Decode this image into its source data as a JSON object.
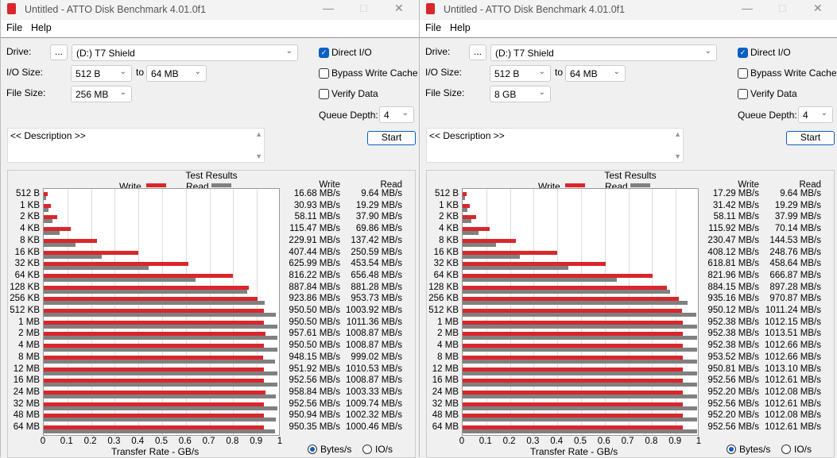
{
  "windows": [
    {
      "title": "Untitled - ATTO Disk Benchmark 4.01.0f1",
      "menu": [
        "File",
        "Help"
      ],
      "drive_label": "Drive:",
      "browse_label": "...",
      "drive": "(D:) T7 Shield",
      "io_size_label": "I/O Size:",
      "io_from": "512 B",
      "to_label": "to",
      "io_to": "64 MB",
      "file_size_label": "File Size:",
      "file_size": "256 MB",
      "direct_io": {
        "label": "Direct I/O",
        "checked": true
      },
      "bypass_write_cache": {
        "label": "Bypass Write Cache",
        "checked": false
      },
      "verify_data": {
        "label": "Verify Data",
        "checked": false
      },
      "queue_depth_label": "Queue Depth:",
      "queue_depth": "4",
      "description": "<< Description >>",
      "start_label": "Start",
      "results_title": "Test Results",
      "legend_write": "Write",
      "legend_read": "Read",
      "col_write": "Write",
      "col_read": "Read",
      "axis_label": "Transfer Rate - GB/s",
      "ticks": [
        "0",
        "0.1",
        "0.2",
        "0.3",
        "0.4",
        "0.5",
        "0.6",
        "0.7",
        "0.8",
        "0.9",
        "1"
      ],
      "radio_bytes": "Bytes/s",
      "radio_io": "IO/s",
      "units_selected": "bytes",
      "rows": [
        "512 B",
        "1 KB",
        "2 KB",
        "4 KB",
        "8 KB",
        "16 KB",
        "32 KB",
        "64 KB",
        "128 KB",
        "256 KB",
        "512 KB",
        "1 MB",
        "2 MB",
        "4 MB",
        "8 MB",
        "12 MB",
        "16 MB",
        "24 MB",
        "32 MB",
        "48 MB",
        "64 MB"
      ],
      "write": [
        "16.68 MB/s",
        "30.93 MB/s",
        "58.11 MB/s",
        "115.47 MB/s",
        "229.91 MB/s",
        "407.44 MB/s",
        "625.99 MB/s",
        "816.22 MB/s",
        "887.84 MB/s",
        "923.86 MB/s",
        "950.50 MB/s",
        "950.50 MB/s",
        "957.61 MB/s",
        "950.50 MB/s",
        "948.15 MB/s",
        "951.92 MB/s",
        "952.56 MB/s",
        "958.84 MB/s",
        "952.56 MB/s",
        "950.94 MB/s",
        "950.35 MB/s"
      ],
      "read": [
        "9.64 MB/s",
        "19.29 MB/s",
        "37.90 MB/s",
        "69.86 MB/s",
        "137.42 MB/s",
        "250.59 MB/s",
        "453.54 MB/s",
        "656.48 MB/s",
        "881.28 MB/s",
        "953.73 MB/s",
        "1003.92 MB/s",
        "1011.36 MB/s",
        "1008.87 MB/s",
        "1008.87 MB/s",
        "999.02 MB/s",
        "1010.53 MB/s",
        "1008.87 MB/s",
        "1003.33 MB/s",
        "1009.74 MB/s",
        "1002.32 MB/s",
        "1000.46 MB/s"
      ]
    },
    {
      "title": "Untitled - ATTO Disk Benchmark 4.01.0f1",
      "menu": [
        "File",
        "Help"
      ],
      "drive_label": "Drive:",
      "browse_label": "...",
      "drive": "(D:) T7 Shield",
      "io_size_label": "I/O Size:",
      "io_from": "512 B",
      "to_label": "to",
      "io_to": "64 MB",
      "file_size_label": "File Size:",
      "file_size": "8 GB",
      "direct_io": {
        "label": "Direct I/O",
        "checked": true
      },
      "bypass_write_cache": {
        "label": "Bypass Write Cache",
        "checked": false
      },
      "verify_data": {
        "label": "Verify Data",
        "checked": false
      },
      "queue_depth_label": "Queue Depth:",
      "queue_depth": "4",
      "description": "<< Description >>",
      "start_label": "Start",
      "results_title": "Test Results",
      "legend_write": "Write",
      "legend_read": "Read",
      "col_write": "Write",
      "col_read": "Read",
      "axis_label": "Transfer Rate - GB/s",
      "ticks": [
        "0",
        "0.1",
        "0.2",
        "0.3",
        "0.4",
        "0.5",
        "0.6",
        "0.7",
        "0.8",
        "0.9",
        "1"
      ],
      "radio_bytes": "Bytes/s",
      "radio_io": "IO/s",
      "units_selected": "bytes",
      "rows": [
        "512 B",
        "1 KB",
        "2 KB",
        "4 KB",
        "8 KB",
        "16 KB",
        "32 KB",
        "64 KB",
        "128 KB",
        "256 KB",
        "512 KB",
        "1 MB",
        "2 MB",
        "4 MB",
        "8 MB",
        "12 MB",
        "16 MB",
        "24 MB",
        "32 MB",
        "48 MB",
        "64 MB"
      ],
      "write": [
        "17.29 MB/s",
        "31.42 MB/s",
        "58.11 MB/s",
        "115.92 MB/s",
        "230.47 MB/s",
        "408.12 MB/s",
        "618.81 MB/s",
        "821.96 MB/s",
        "884.15 MB/s",
        "935.16 MB/s",
        "950.12 MB/s",
        "952.38 MB/s",
        "952.38 MB/s",
        "952.38 MB/s",
        "953.52 MB/s",
        "950.81 MB/s",
        "952.56 MB/s",
        "952.20 MB/s",
        "952.56 MB/s",
        "952.20 MB/s",
        "952.56 MB/s"
      ],
      "read": [
        "9.64 MB/s",
        "19.29 MB/s",
        "37.99 MB/s",
        "70.14 MB/s",
        "144.53 MB/s",
        "248.76 MB/s",
        "458.64 MB/s",
        "666.87 MB/s",
        "897.28 MB/s",
        "970.87 MB/s",
        "1011.24 MB/s",
        "1012.15 MB/s",
        "1013.51 MB/s",
        "1012.66 MB/s",
        "1012.66 MB/s",
        "1013.10 MB/s",
        "1012.61 MB/s",
        "1012.08 MB/s",
        "1012.61 MB/s",
        "1012.08 MB/s",
        "1012.61 MB/s"
      ]
    }
  ],
  "colors": {
    "write": "#d9262c",
    "read": "#808080",
    "accent": "#0a5fc2"
  }
}
